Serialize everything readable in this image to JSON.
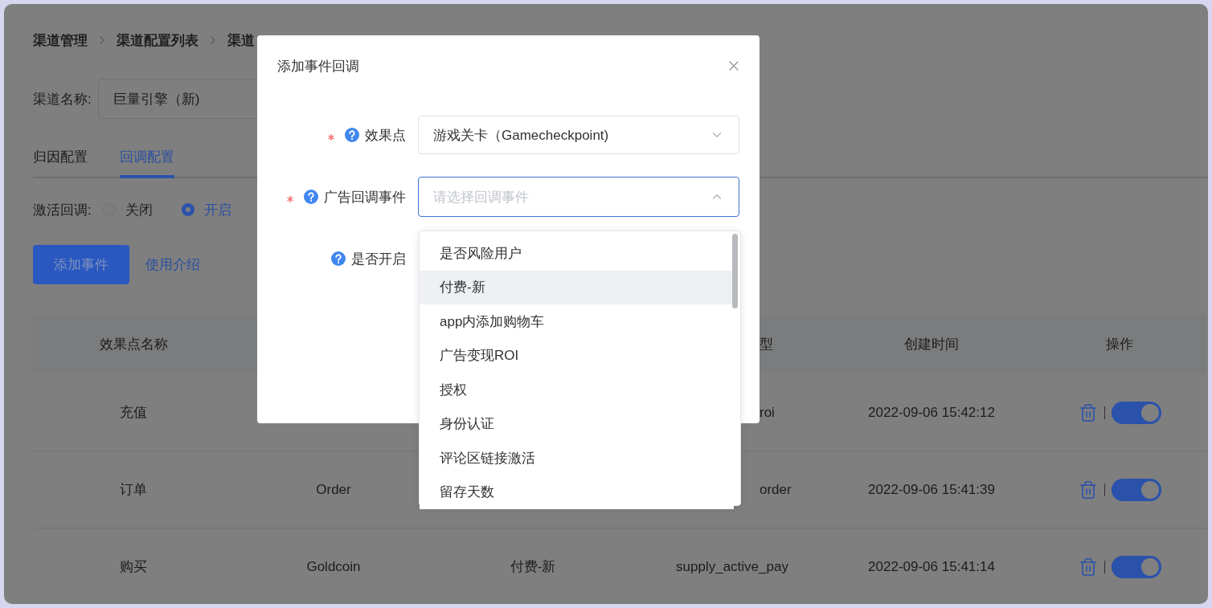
{
  "breadcrumb": [
    "渠道管理",
    "渠道配置列表",
    "渠道"
  ],
  "channel": {
    "label": "渠道名称:",
    "value": "巨量引擎（新)"
  },
  "tabs": [
    {
      "label": "归因配置",
      "selected": false
    },
    {
      "label": "回调配置",
      "selected": true
    }
  ],
  "activation": {
    "label": "激活回调:",
    "options": [
      {
        "label": "关闭",
        "selected": false
      },
      {
        "label": "开启",
        "selected": true
      }
    ]
  },
  "actions": {
    "primary": "添加事件",
    "link": "使用介绍"
  },
  "table": {
    "header": {
      "column_1": "效果点名称",
      "column_4": {
        "text": "型",
        "cut": true
      },
      "column_5": "创建时间",
      "column_6": "操作"
    },
    "rows": [
      {
        "column_1": "充值",
        "column_4": {
          "text": "roi",
          "cut": true
        },
        "column_5": "2022-09-06 15:42:12",
        "enabled": true
      },
      {
        "column_1": "订单",
        "column_2": "Order",
        "column_4": {
          "text": "order",
          "cut": true
        },
        "column_5": "2022-09-06 15:41:39",
        "enabled": true
      },
      {
        "column_1": "购买",
        "column_2": "Goldcoin",
        "column_3": "付费-新",
        "column_4": {
          "text": "supply_active_pay",
          "cut": false
        },
        "column_5": "2022-09-06 15:41:14",
        "enabled": true
      }
    ]
  },
  "dialog": {
    "title": "添加事件回调",
    "fields": [
      {
        "label": "效果点",
        "required": true,
        "help": true,
        "select": {
          "value": "游戏关卡（Gamecheckpoint)",
          "open": false
        }
      },
      {
        "label": "广告回调事件",
        "required": true,
        "help": true,
        "select": {
          "placeholder": "请选择回调事件",
          "open": true
        }
      },
      {
        "label": "是否开启",
        "required": false,
        "help": true
      }
    ]
  },
  "dropdown": {
    "options": [
      {
        "label": "是否风险用户",
        "highlighted": false
      },
      {
        "label": "付费-新",
        "highlighted": true
      },
      {
        "label": "app内添加购物车",
        "highlighted": false
      },
      {
        "label": "广告变现ROI",
        "highlighted": false
      },
      {
        "label": "授权",
        "highlighted": false
      },
      {
        "label": "身份认证",
        "highlighted": false
      },
      {
        "label": "评论区链接激活",
        "highlighted": false
      },
      {
        "label": "留存天数",
        "highlighted": false
      }
    ]
  }
}
